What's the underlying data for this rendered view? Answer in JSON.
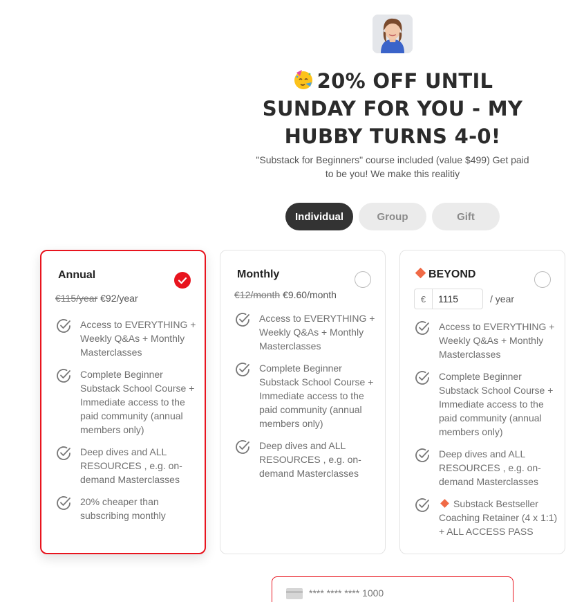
{
  "header": {
    "headline": "20% OFF UNTIL SUNDAY FOR YOU - MY HUBBY TURNS 4-0!",
    "emoji_icon": "party-face-icon",
    "subtitle": "\"Substack for Beginners\" course included (value $499) Get paid to be you! We make this realitiy"
  },
  "tabs": [
    {
      "label": "Individual",
      "active": true
    },
    {
      "label": "Group",
      "active": false
    },
    {
      "label": "Gift",
      "active": false
    }
  ],
  "plans": {
    "annual": {
      "title": "Annual",
      "selected": true,
      "old_price": "€115/year",
      "new_price": "€92/year",
      "features": [
        "Access to EVERYTHING + Weekly Q&As + Monthly Masterclasses",
        "Complete Beginner Substack School Course + Immediate access to the paid community (annual members only)",
        "Deep dives and ALL RESOURCES , e.g. on-demand Masterclasses",
        "20% cheaper than subscribing monthly"
      ]
    },
    "monthly": {
      "title": "Monthly",
      "selected": false,
      "old_price": "€12/month",
      "new_price": "€9.60/month",
      "features": [
        "Access to EVERYTHING + Weekly Q&As + Monthly Masterclasses",
        "Complete Beginner Substack School Course + Immediate access to the paid community (annual members only)",
        "Deep dives and ALL RESOURCES , e.g. on-demand Masterclasses"
      ]
    },
    "beyond": {
      "title": "BEYOND",
      "selected": false,
      "currency": "€",
      "amount": "1115",
      "period": "/ year",
      "features": [
        "Access to EVERYTHING + Weekly Q&As + Monthly Masterclasses",
        "Complete Beginner Substack School Course + Immediate access to the paid community (annual members only)",
        "Deep dives and ALL RESOURCES , e.g. on-demand Masterclasses",
        "Substack Bestseller Coaching Retainer (4 x 1:1) + ALL ACCESS PASS"
      ]
    }
  },
  "payment": {
    "card_number": "**** **** **** 1000"
  },
  "colors": {
    "accent": "#e8141e",
    "dark": "#333333",
    "diamond": "#f06a46"
  }
}
